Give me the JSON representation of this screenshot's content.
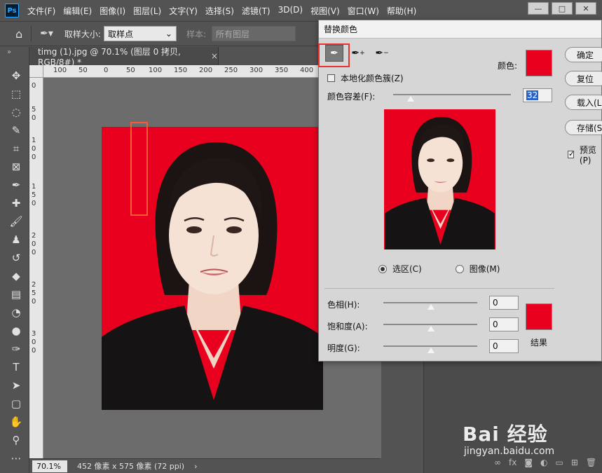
{
  "app": {
    "logo_text": "Ps"
  },
  "menu": [
    "文件(F)",
    "编辑(E)",
    "图像(I)",
    "图层(L)",
    "文字(Y)",
    "选择(S)",
    "滤镜(T)",
    "3D(D)",
    "视图(V)",
    "窗口(W)",
    "帮助(H)"
  ],
  "window_controls": {
    "minimize": "—",
    "maximize": "□",
    "close": "✕"
  },
  "options_bar": {
    "sample_size_label": "取样大小:",
    "sample_size_value": "取样点",
    "sample_label": "样本:",
    "sample_value": "所有图层"
  },
  "document": {
    "tab_title": "timg (1).jpg @ 70.1% (图层 0 拷贝, RGB/8#) *",
    "close_glyph": "×"
  },
  "ruler": {
    "h_labels": [
      "100",
      "50",
      "0",
      "50",
      "100",
      "150",
      "200",
      "250",
      "300",
      "350",
      "400"
    ],
    "v_labels": [
      "0",
      "5",
      "0",
      "1",
      "0",
      "0",
      "1",
      "5",
      "0",
      "2",
      "0",
      "0",
      "2",
      "5",
      "0",
      "3",
      "0",
      "0"
    ]
  },
  "status_bar": {
    "zoom": "70.1%",
    "info": "452 像素 x 575 像素 (72 ppi)",
    "arrow": "›"
  },
  "dialog": {
    "title": "替换颜色",
    "color_label": "颜色:",
    "localized_label": "本地化颜色簇(Z)",
    "fuzziness_label": "颜色容差(F):",
    "fuzziness_value": "32",
    "selection_label": "选区(C)",
    "image_label": "图像(M)",
    "hue_label": "色相(H):",
    "hue_value": "0",
    "saturation_label": "饱和度(A):",
    "saturation_value": "0",
    "lightness_label": "明度(G):",
    "lightness_value": "0",
    "result_label": "结果",
    "buttons": {
      "ok": "确定",
      "reset": "复位",
      "load": "载入(L)...",
      "save": "存储(S)..."
    },
    "preview_label": "预览(P)"
  },
  "watermark": {
    "line1": "Bai 经验",
    "line2": "jingyan.baidu.com"
  },
  "colors": {
    "background_red": "#e8001e",
    "highlight_red": "#e8322f",
    "ps_dark": "#535353"
  }
}
